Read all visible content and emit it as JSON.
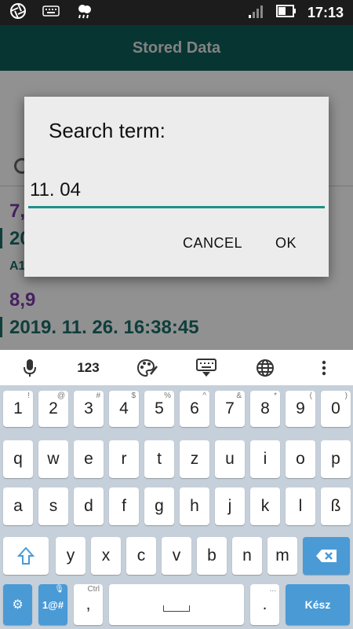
{
  "status_bar": {
    "time": "17:13"
  },
  "app_bar": {
    "title": "Stored Data"
  },
  "background_list": {
    "entries": [
      {
        "value": "7,",
        "datetime": "20",
        "extra": "A1"
      },
      {
        "value": "8,9",
        "datetime": "2019. 11. 26. 16:38:45"
      }
    ]
  },
  "dialog": {
    "title": "Search term:",
    "input_value": "11. 04",
    "cancel_label": "CANCEL",
    "ok_label": "OK"
  },
  "keyboard_toolbar": {
    "numbers_label": "123"
  },
  "keyboard": {
    "row1": [
      {
        "k": "1",
        "h": "!"
      },
      {
        "k": "2",
        "h": "@"
      },
      {
        "k": "3",
        "h": "#"
      },
      {
        "k": "4",
        "h": "$"
      },
      {
        "k": "5",
        "h": "%"
      },
      {
        "k": "6",
        "h": "^"
      },
      {
        "k": "7",
        "h": "&"
      },
      {
        "k": "8",
        "h": "*"
      },
      {
        "k": "9",
        "h": "("
      },
      {
        "k": "0",
        "h": ")"
      }
    ],
    "row2": [
      "q",
      "w",
      "e",
      "r",
      "t",
      "z",
      "u",
      "i",
      "o",
      "p"
    ],
    "row3": [
      "a",
      "s",
      "d",
      "f",
      "g",
      "h",
      "j",
      "k",
      "l",
      "ß"
    ],
    "row4": [
      "y",
      "x",
      "c",
      "v",
      "b",
      "n",
      "m"
    ],
    "symbols_label": "1@#",
    "comma": ",",
    "comma_hint": "Ctrl",
    "period": ".",
    "period_hint": "...",
    "enter_label": "Kész"
  },
  "colors": {
    "app_bar": "#0d5c57",
    "accent": "#1f8f89",
    "purple_value": "#7b3aa8",
    "key_blue": "#4a9ad6"
  }
}
